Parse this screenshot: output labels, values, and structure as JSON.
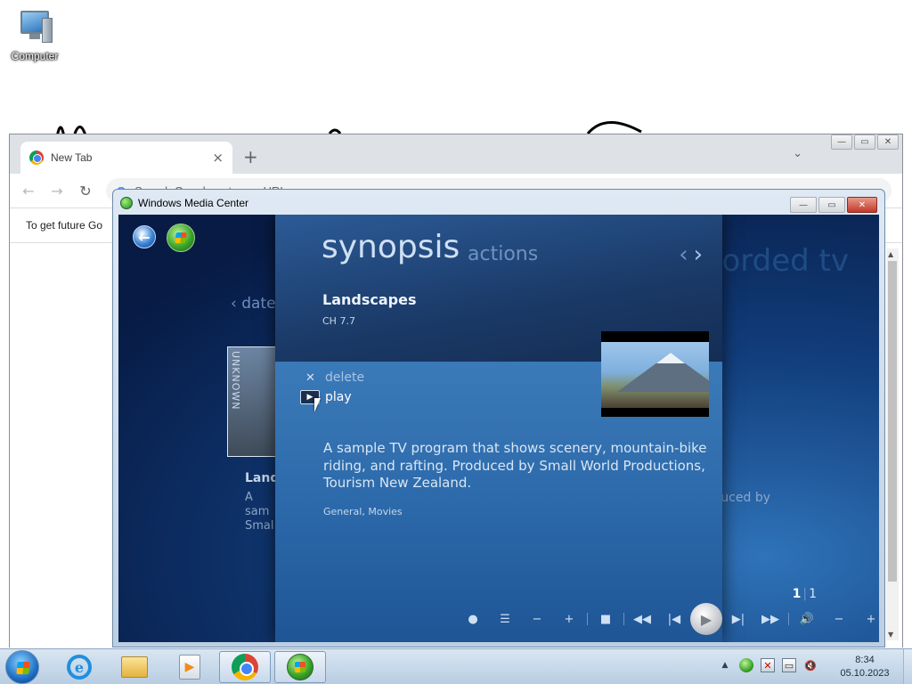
{
  "desktop": {
    "icon_label": "Computer",
    "icon": "computer-icon"
  },
  "chrome": {
    "tab_title": "New Tab",
    "tab_close": "×",
    "new_tab": "+",
    "tab_menu": "⌄",
    "omnibox_placeholder": "Search Google or type a URL",
    "infobar_text": "To get future Go",
    "window_buttons": [
      "—",
      "▭",
      "✕"
    ]
  },
  "wmc": {
    "window_title": "Windows Media Center",
    "window_buttons": [
      "—",
      "▭",
      "✕"
    ],
    "background": {
      "date_label": "date",
      "date_chevron": "‹",
      "thumb_text": "UNKNOWN",
      "program_title_partial": "Land",
      "desc_partial_1": "A sam",
      "desc_partial_2": "Smal",
      "section_title_partial": "orded tv",
      "produced_partial": "uced by",
      "page_current": "1",
      "page_total": "1"
    },
    "dialog": {
      "heading": "synopsis",
      "tab_actions": "actions",
      "nav_prev": "‹",
      "nav_next": "›",
      "program_title": "Landscapes",
      "channel": "CH 7.7",
      "actions": [
        {
          "label": "delete",
          "icon": "close-icon"
        },
        {
          "label": "play",
          "icon": "play-icon"
        }
      ],
      "description": "A sample TV program that shows scenery, mountain-bike riding, and rafting. Produced by Small World Productions, Tourism New Zealand.",
      "genres": "General, Movies"
    },
    "transport": [
      "record",
      "guide",
      "channel-down",
      "channel-up",
      "stop",
      "rewind",
      "previous",
      "play",
      "next",
      "fast-forward",
      "mute",
      "volume-down",
      "volume-up"
    ]
  },
  "taskbar": {
    "pinned": [
      "internet-explorer",
      "windows-explorer",
      "media-player",
      "chrome",
      "media-center"
    ],
    "active": "media-center",
    "clock_time": "8:34",
    "clock_date": "05.10.2023"
  },
  "colors": {
    "wmc_dark": "#0d2b5c",
    "wmc_accent": "#3b7ab9",
    "taskbar": "#c6d8ea"
  }
}
